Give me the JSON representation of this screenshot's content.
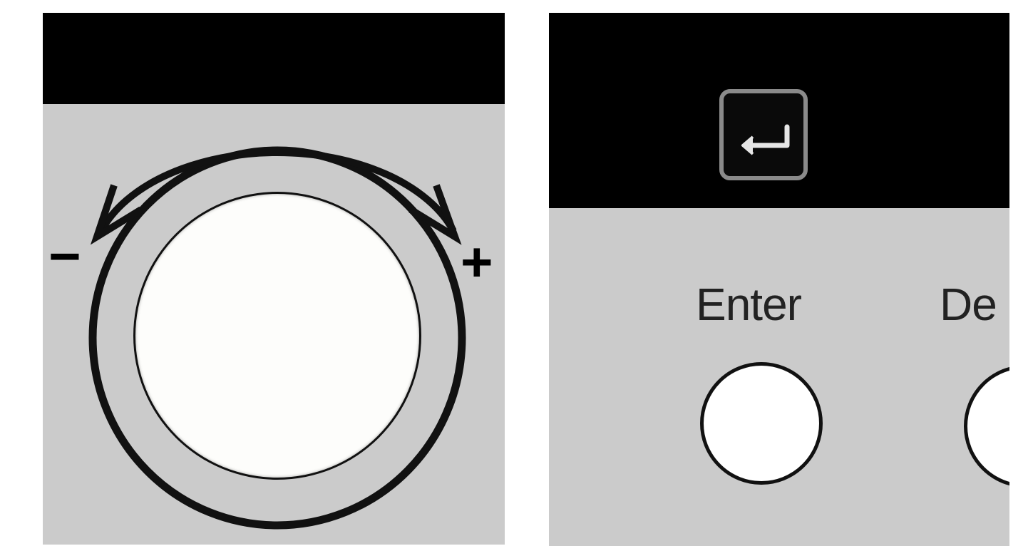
{
  "dial_panel": {
    "minus_label": "−",
    "plus_label": "+",
    "icons": {
      "ccw_arrow": "counterclockwise-arrow-icon",
      "cw_arrow": "clockwise-arrow-icon"
    }
  },
  "buttons_panel": {
    "header_icon": "enter-return-icon",
    "buttons": [
      {
        "label": "Enter"
      },
      {
        "label": "De"
      }
    ]
  },
  "colors": {
    "panel_bg": "#cbcbcb",
    "header_bg": "#000000",
    "knob": "#fdfdfb",
    "outline": "#111111"
  }
}
